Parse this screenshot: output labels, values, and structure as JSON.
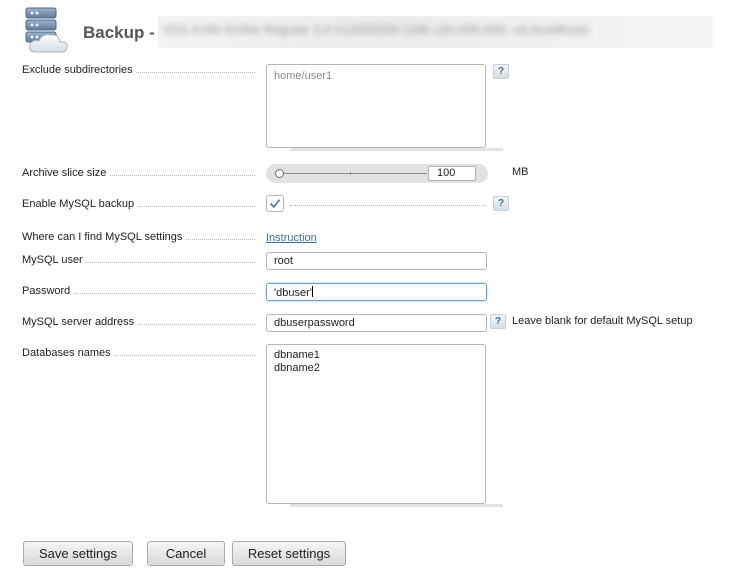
{
  "header": {
    "title": "Backup - ",
    "redacted_subtitle": "VDS KVM NVMe Regular 3.0 #13000000 (188.120.000.000, vd.itsoldhost)",
    "icon": "server-cloud-icon"
  },
  "fields": {
    "exclude_subdirectories": {
      "label": "Exclude subdirectories",
      "placeholder": "home/user1",
      "help": "?"
    },
    "archive_slice_size": {
      "label": "Archive slice size",
      "value": "100",
      "unit": "MB"
    },
    "enable_mysql_backup": {
      "label": "Enable MySQL backup",
      "checked": true,
      "help": "?"
    },
    "mysql_settings": {
      "label": "Where can I find MySQL settings",
      "link": "Instruction"
    },
    "mysql_user": {
      "label": "MySQL user",
      "value": "root"
    },
    "password": {
      "label": "Password",
      "value": "'dbuser'"
    },
    "mysql_server_address": {
      "label": "MySQL server address",
      "value": "dbuserpassword",
      "help": "?",
      "hint": "Leave blank for default MySQL setup"
    },
    "databases_names": {
      "label": "Databases names",
      "lines": [
        "dbname1",
        "dbname2"
      ]
    }
  },
  "buttons": {
    "save": "Save settings",
    "cancel": "Cancel",
    "reset": "Reset settings"
  },
  "colors": {
    "link": "#3f6f99",
    "title": "#555555"
  }
}
